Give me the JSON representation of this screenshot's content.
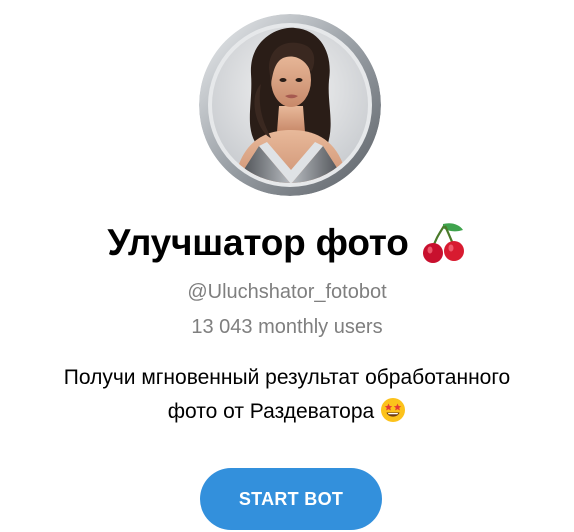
{
  "bot": {
    "title": "Улучшатор фото",
    "title_emoji": "cherries-emoji",
    "username": "@Uluchshator_fotobot",
    "monthly_users": "13 043 monthly users",
    "description_line1": "Получи мгновенный результат обработанного",
    "description_line2": "фото от Раздеватора",
    "description_emoji": "star-struck-emoji",
    "avatar": "bot-avatar-portrait"
  },
  "actions": {
    "start_label": "START BOT"
  },
  "colors": {
    "accent": "#3390dc",
    "secondary_text": "#7f7f7f",
    "primary_text": "#000000"
  }
}
